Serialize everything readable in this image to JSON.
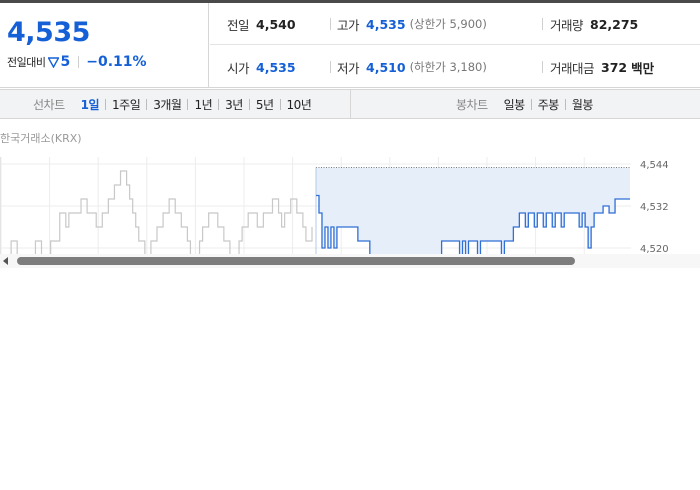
{
  "summary": {
    "price": "4,535",
    "change_label": "전일대비",
    "change_value": "5",
    "change_pct": "−0.11%"
  },
  "info": {
    "prev_label": "전일",
    "prev_value": "4,540",
    "high_label": "고가",
    "high_value": "4,535",
    "high_sub": "(상한가 5,900)",
    "volume_label": "거래량",
    "volume_value": "82,275",
    "open_label": "시가",
    "open_value": "4,535",
    "low_label": "저가",
    "low_value": "4,510",
    "low_sub": "(하한가 3,180)",
    "amount_label": "거래대금",
    "amount_value": "372",
    "amount_unit": "백만"
  },
  "line_chart_bar": {
    "label": "선차트",
    "tabs": [
      "1일",
      "1주일",
      "3개월",
      "1년",
      "3년",
      "5년",
      "10년"
    ],
    "active": "1일"
  },
  "candle_chart_bar": {
    "label": "봉차트",
    "tabs": [
      "일봉",
      "주봉",
      "월봉"
    ]
  },
  "chart": {
    "exchange": "한국거래소(KRX)",
    "colors": {
      "prev_session": "#c8c8c8",
      "today": "#2f6fd6",
      "fill": "#e6eefa",
      "grid": "#ececec"
    },
    "chart_data": {
      "type": "line",
      "y_ticks": [
        "4,544",
        "4,532",
        "4,520"
      ],
      "ylim": [
        4518,
        4546
      ],
      "grid": true,
      "series": [
        {
          "values": [
            4518,
            4518,
            4518,
            4522,
            4522,
            4518,
            4518,
            4518,
            4518,
            4518,
            4518,
            4522,
            4522,
            4518,
            4518,
            4518,
            4522,
            4522,
            4522,
            4530,
            4530,
            4526,
            4530,
            4530,
            4530,
            4530,
            4534,
            4534,
            4530,
            4530,
            4530,
            4526,
            4526,
            4530,
            4530,
            4534,
            4534,
            4538,
            4538,
            4542,
            4542,
            4538,
            4534,
            4530,
            4526,
            4522,
            4522,
            4518,
            4518,
            4522,
            4522,
            4526,
            4526,
            4530,
            4530,
            4534,
            4534,
            4530,
            4530,
            4526,
            4526,
            4522,
            4518,
            4518,
            4518,
            4522,
            4526,
            4526,
            4530,
            4530,
            4530,
            4526,
            4526,
            4522,
            4522,
            4518,
            4518,
            4518,
            4522,
            4526,
            4526,
            4530,
            4530,
            4530,
            4526,
            4526,
            4530,
            4530,
            4530,
            4534,
            4534,
            4530,
            4526,
            4530,
            4530,
            4534,
            4534,
            4530,
            4530,
            4526,
            4522,
            4522,
            4526
          ]
        },
        {
          "values": [
            4535,
            4530,
            4520,
            4526,
            4520,
            4526,
            4520,
            4526,
            4526,
            4526,
            4526,
            4526,
            4526,
            4526,
            4522,
            4522,
            4522,
            4522,
            4518,
            4518,
            4518,
            4518,
            4518,
            4518,
            4518,
            4518,
            4518,
            4518,
            4518,
            4518,
            4518,
            4518,
            4518,
            4518,
            4518,
            4518,
            4518,
            4518,
            4518,
            4518,
            4518,
            4518,
            4522,
            4522,
            4522,
            4522,
            4522,
            4522,
            4518,
            4522,
            4518,
            4522,
            4522,
            4522,
            4518,
            4522,
            4522,
            4522,
            4522,
            4522,
            4522,
            4522,
            4518,
            4522,
            4522,
            4522,
            4526,
            4526,
            4530,
            4530,
            4526,
            4530,
            4530,
            4526,
            4530,
            4530,
            4526,
            4530,
            4530,
            4526,
            4530,
            4530,
            4526,
            4530,
            4530,
            4530,
            4530,
            4530,
            4526,
            4530,
            4526,
            4520,
            4526,
            4530,
            4530,
            4530,
            4532,
            4532,
            4530,
            4530,
            4534,
            4534,
            4534,
            4534,
            4534,
            4534
          ]
        }
      ]
    }
  },
  "scrollbar": {}
}
